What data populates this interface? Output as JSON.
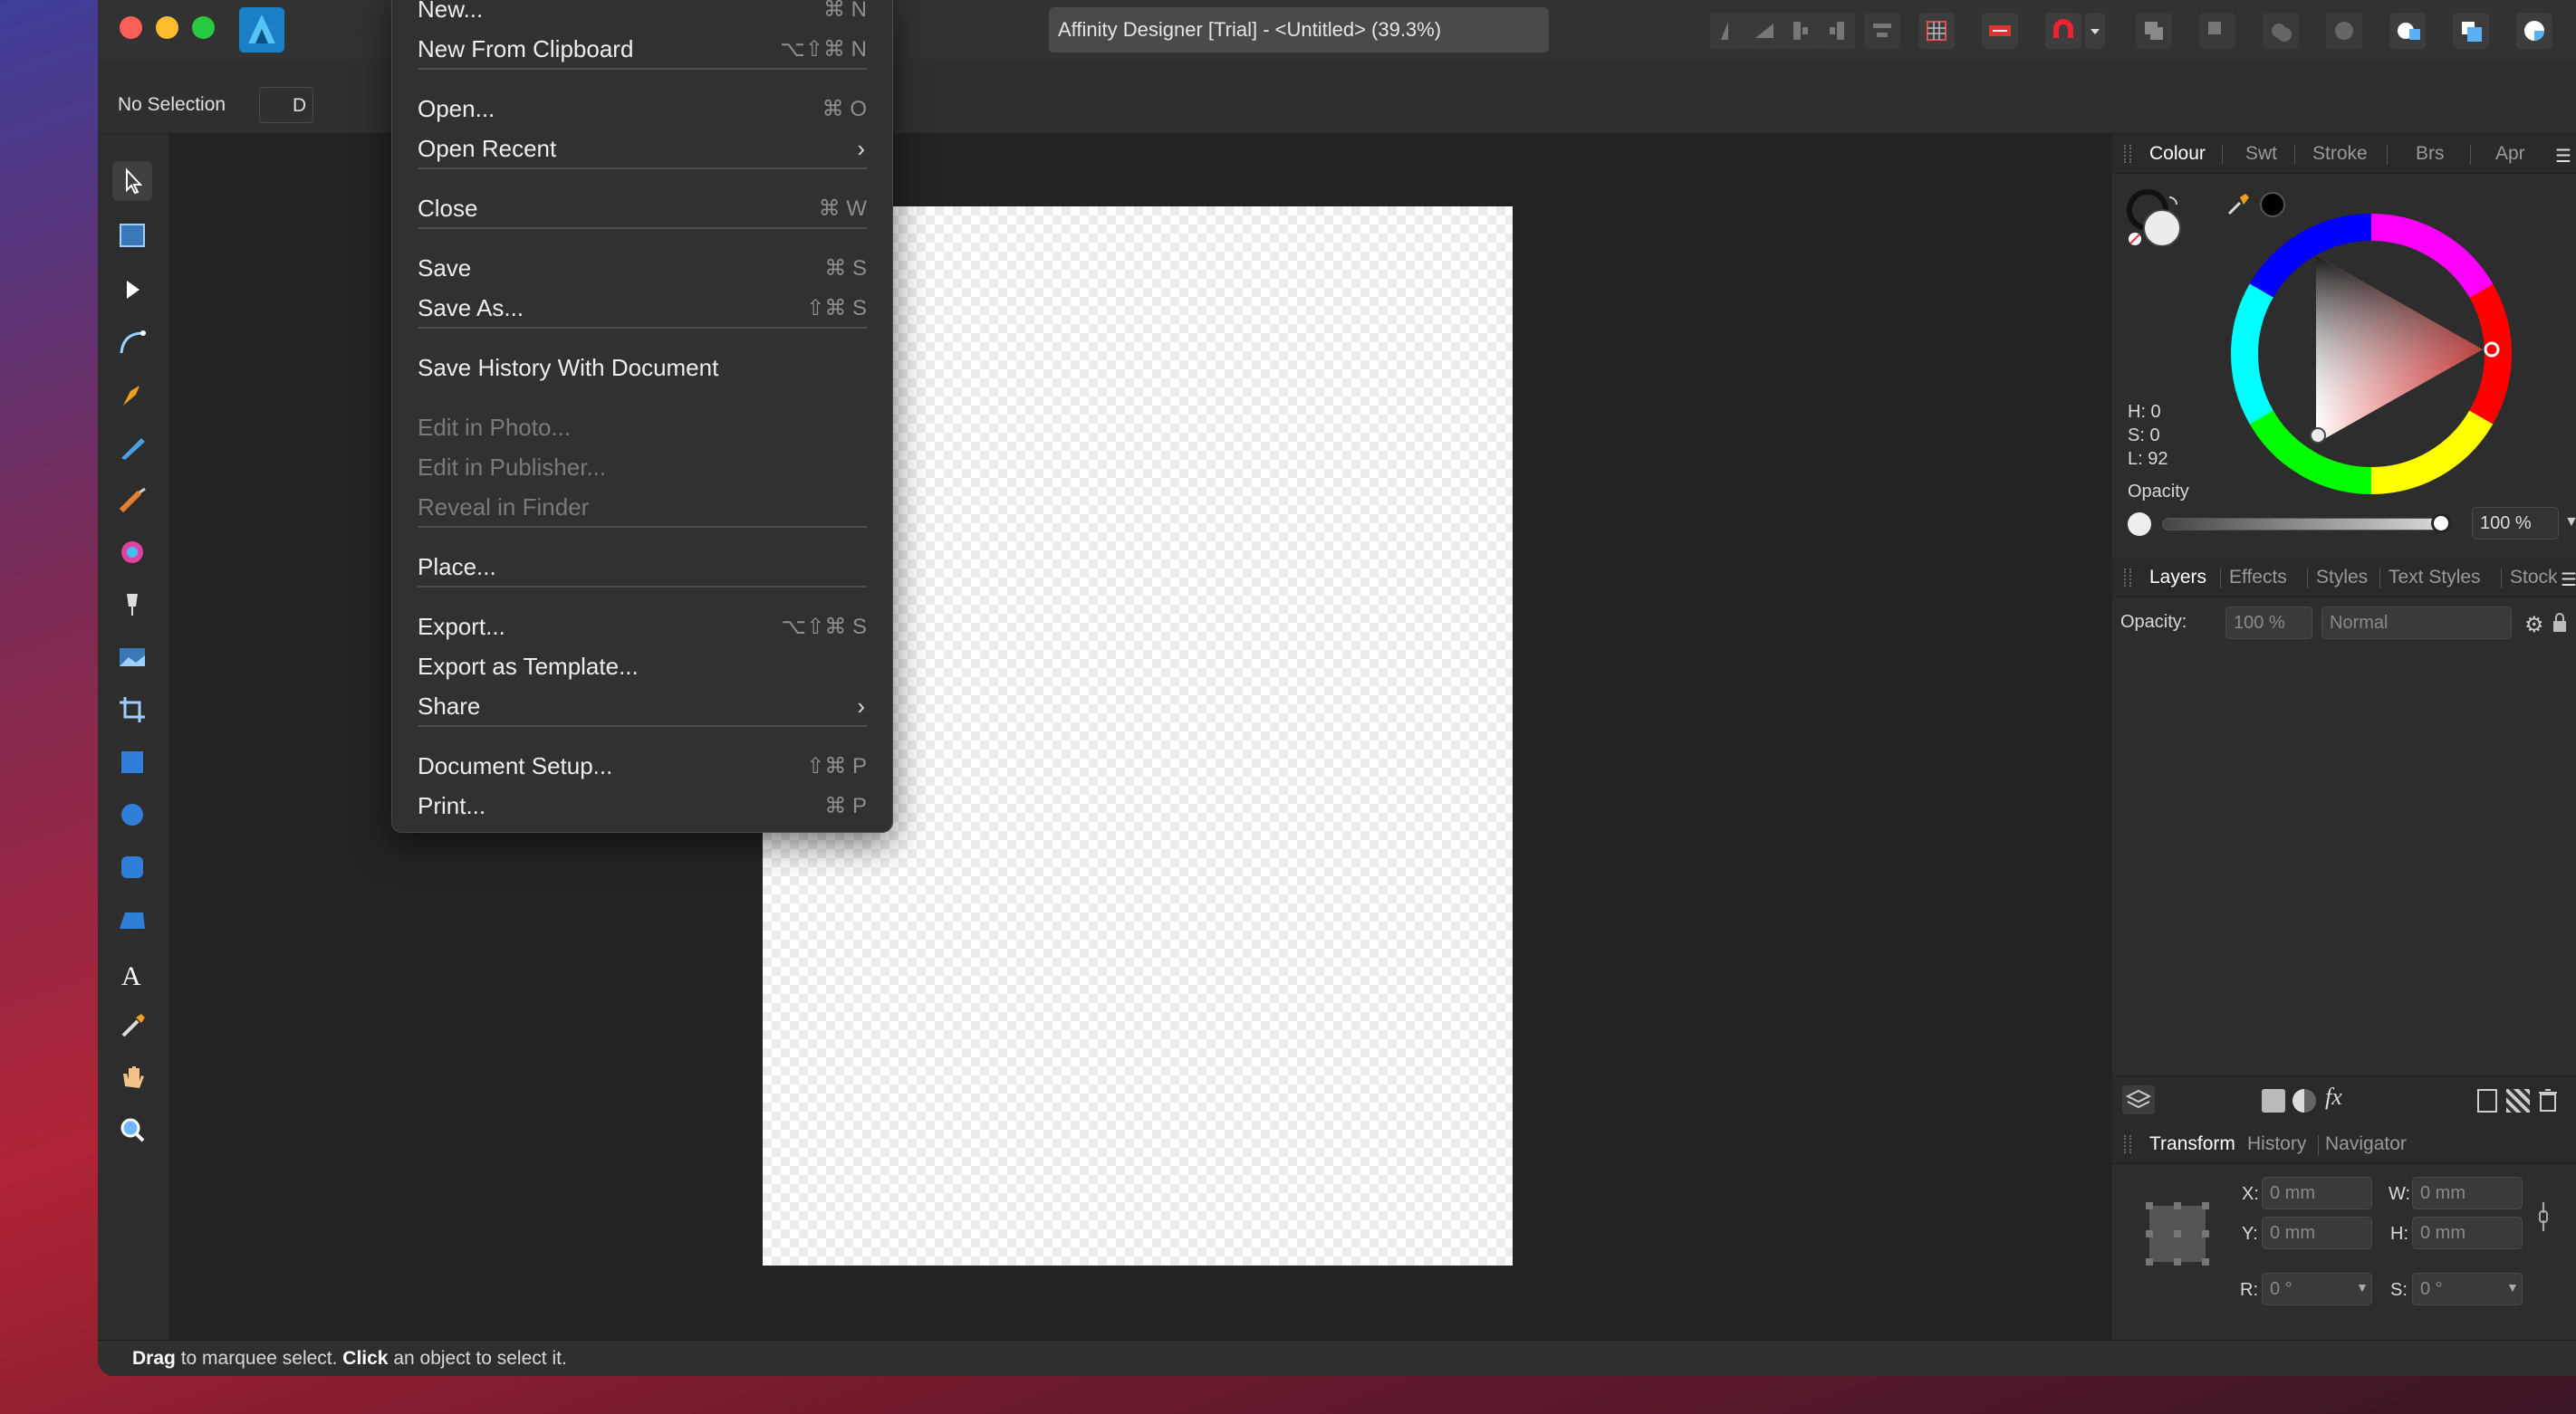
{
  "window": {
    "title": "Affinity Designer [Trial] - <Untitled> (39.3%)",
    "traffic_light_colors": [
      "#fe5f57",
      "#febc2e",
      "#28c840"
    ]
  },
  "context_toolbar": {
    "selection_label": "No Selection",
    "button_fragment": "D"
  },
  "file_menu": {
    "items": [
      {
        "label": "New...",
        "shortcut": "⌘ N"
      },
      {
        "label": "New From Clipboard",
        "shortcut": "⌥⇧⌘ N"
      },
      {
        "label": "Open...",
        "shortcut": "⌘ O"
      },
      {
        "label": "Open Recent",
        "submenu_arrow": "›"
      },
      {
        "label": "Close",
        "shortcut": "⌘ W"
      },
      {
        "label": "Save",
        "shortcut": "⌘ S"
      },
      {
        "label": "Save As...",
        "shortcut": "⇧⌘ S"
      },
      {
        "label": "Save History With Document"
      },
      {
        "label": "Edit in Photo...",
        "disabled": true
      },
      {
        "label": "Edit in Publisher...",
        "disabled": true
      },
      {
        "label": "Reveal in Finder",
        "disabled": true
      },
      {
        "label": "Place..."
      },
      {
        "label": "Export...",
        "shortcut": "⌥⇧⌘ S"
      },
      {
        "label": "Export as Template..."
      },
      {
        "label": "Share",
        "submenu_arrow": "›"
      },
      {
        "label": "Document Setup...",
        "shortcut": "⇧⌘ P"
      },
      {
        "label": "Print...",
        "shortcut": "⌘ P"
      }
    ]
  },
  "colour_panel": {
    "tabs": [
      "Colour",
      "Swt",
      "Stroke",
      "Brs",
      "Apr"
    ],
    "h_label": "H: 0",
    "s_label": "S: 0",
    "l_label": "L: 92",
    "opacity_label": "Opacity",
    "opacity_value": "100 %",
    "opacity_fraction": 1.0
  },
  "layers_panel": {
    "tabs": [
      "Layers",
      "Effects",
      "Styles",
      "Text Styles",
      "Stock"
    ],
    "opacity_label": "Opacity:",
    "opacity_value": "100 %",
    "blend_mode": "Normal"
  },
  "transform_panel": {
    "tabs": [
      "Transform",
      "History",
      "Navigator"
    ],
    "x_label": "X:",
    "x_value": "0 mm",
    "y_label": "Y:",
    "y_value": "0 mm",
    "w_label": "W:",
    "w_value": "0 mm",
    "h_label": "H:",
    "h_value": "0 mm",
    "r_label": "R:",
    "r_value": "0 °",
    "s_label": "S:",
    "s_value": "0 °"
  },
  "status_bar": {
    "bold1": "Drag",
    "text1": " to marquee select. ",
    "bold2": "Click",
    "text2": " an object to select it."
  }
}
